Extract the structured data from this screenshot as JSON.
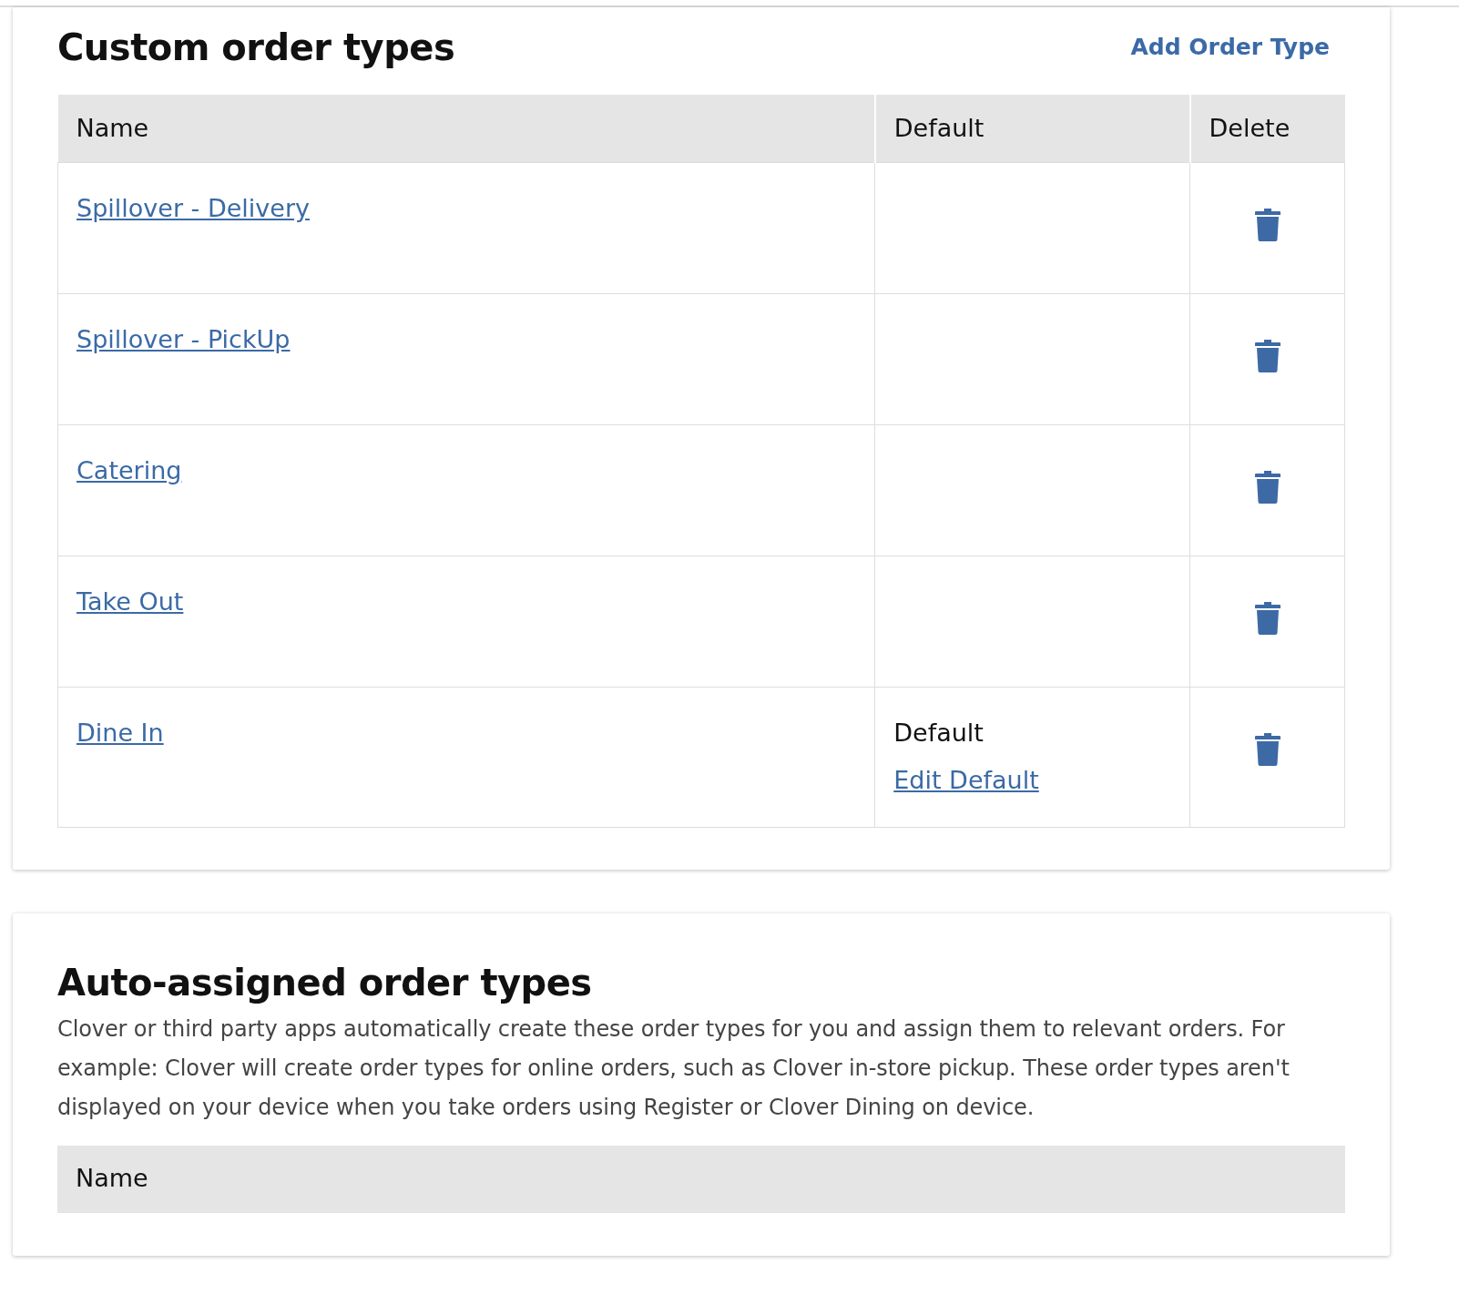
{
  "custom_section": {
    "title": "Custom order types",
    "add_link": "Add Order Type",
    "columns": [
      "Name",
      "Default",
      "Delete"
    ],
    "rows": [
      {
        "name": "Spillover - Delivery"
      },
      {
        "name": "Spillover - PickUp"
      },
      {
        "name": "Catering"
      },
      {
        "name": "Take Out"
      },
      {
        "name": "Dine In",
        "default": "Default",
        "edit_link": "Edit Default"
      }
    ]
  },
  "auto_section": {
    "title": "Auto-assigned order types",
    "description": "Clover or third party apps automatically create these order types for you and assign them to relevant orders. For example: Clover will create order types for online orders, such as Clover in-store pickup. These order types aren't displayed on your device when you take orders using Register or Clover Dining on device.",
    "columns": [
      "Name"
    ]
  }
}
